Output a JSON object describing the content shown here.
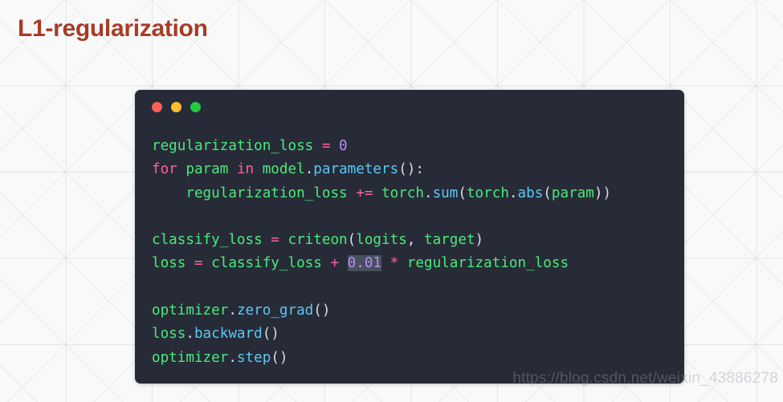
{
  "slide": {
    "title": "L1-regularization",
    "title_color": "#a73c27",
    "background_color": "#f9f9fa"
  },
  "code_window": {
    "background_color": "#272b37",
    "language": "python",
    "traffic_lights": [
      {
        "name": "close-dot",
        "color": "#ff5f56"
      },
      {
        "name": "minimize-dot",
        "color": "#ffbd2e"
      },
      {
        "name": "maximize-dot",
        "color": "#27c93f"
      }
    ],
    "colors": {
      "default_text": "#4aea7b",
      "keyword": "#ff5fa2",
      "operator": "#ff5fa2",
      "number": "#b48ef7",
      "attribute": "#5bc8f5",
      "punctuation": "#d8dde8",
      "selection_background": "#4a4f5e"
    },
    "code_plain": "regularization_loss = 0\nfor param in model.parameters():\n    regularization_loss += torch.sum(torch.abs(param))\n\nclassify_loss = criteon(logits, target)\nloss = classify_loss + 0.01 * regularization_loss\n\noptimizer.zero_grad()\nloss.backward()\noptimizer.step()",
    "lines": [
      {
        "index": 1,
        "tokens": [
          {
            "text": "regularization_loss",
            "type": "name"
          },
          {
            "text": " ",
            "type": "plain"
          },
          {
            "text": "=",
            "type": "operator"
          },
          {
            "text": " ",
            "type": "plain"
          },
          {
            "text": "0",
            "type": "number"
          }
        ]
      },
      {
        "index": 2,
        "tokens": [
          {
            "text": "for",
            "type": "keyword"
          },
          {
            "text": " ",
            "type": "plain"
          },
          {
            "text": "param",
            "type": "name"
          },
          {
            "text": " ",
            "type": "plain"
          },
          {
            "text": "in",
            "type": "keyword"
          },
          {
            "text": " ",
            "type": "plain"
          },
          {
            "text": "model",
            "type": "name"
          },
          {
            "text": ".",
            "type": "punctuation"
          },
          {
            "text": "parameters",
            "type": "attribute"
          },
          {
            "text": "()",
            "type": "punctuation"
          },
          {
            "text": ":",
            "type": "punctuation"
          }
        ]
      },
      {
        "index": 3,
        "tokens": [
          {
            "text": "    ",
            "type": "plain"
          },
          {
            "text": "regularization_loss",
            "type": "name"
          },
          {
            "text": " ",
            "type": "plain"
          },
          {
            "text": "+=",
            "type": "operator"
          },
          {
            "text": " ",
            "type": "plain"
          },
          {
            "text": "torch",
            "type": "name"
          },
          {
            "text": ".",
            "type": "punctuation"
          },
          {
            "text": "sum",
            "type": "attribute"
          },
          {
            "text": "(",
            "type": "punctuation"
          },
          {
            "text": "torch",
            "type": "name"
          },
          {
            "text": ".",
            "type": "punctuation"
          },
          {
            "text": "abs",
            "type": "attribute"
          },
          {
            "text": "(",
            "type": "punctuation"
          },
          {
            "text": "param",
            "type": "name"
          },
          {
            "text": "))",
            "type": "punctuation"
          }
        ]
      },
      {
        "index": 4,
        "tokens": []
      },
      {
        "index": 5,
        "tokens": [
          {
            "text": "classify_loss",
            "type": "name"
          },
          {
            "text": " ",
            "type": "plain"
          },
          {
            "text": "=",
            "type": "operator"
          },
          {
            "text": " ",
            "type": "plain"
          },
          {
            "text": "criteon",
            "type": "name"
          },
          {
            "text": "(",
            "type": "punctuation"
          },
          {
            "text": "logits",
            "type": "name"
          },
          {
            "text": ",",
            "type": "punctuation"
          },
          {
            "text": " ",
            "type": "plain"
          },
          {
            "text": "target",
            "type": "name"
          },
          {
            "text": ")",
            "type": "punctuation"
          }
        ]
      },
      {
        "index": 6,
        "tokens": [
          {
            "text": "loss",
            "type": "name"
          },
          {
            "text": " ",
            "type": "plain"
          },
          {
            "text": "=",
            "type": "operator"
          },
          {
            "text": " ",
            "type": "plain"
          },
          {
            "text": "classify_loss",
            "type": "name"
          },
          {
            "text": " ",
            "type": "plain"
          },
          {
            "text": "+",
            "type": "operator"
          },
          {
            "text": " ",
            "type": "plain"
          },
          {
            "text": "0.01",
            "type": "number",
            "selected": true
          },
          {
            "text": " ",
            "type": "plain"
          },
          {
            "text": "*",
            "type": "operator"
          },
          {
            "text": " ",
            "type": "plain"
          },
          {
            "text": "regularization_loss",
            "type": "name"
          }
        ]
      },
      {
        "index": 7,
        "tokens": []
      },
      {
        "index": 8,
        "tokens": [
          {
            "text": "optimizer",
            "type": "name"
          },
          {
            "text": ".",
            "type": "punctuation"
          },
          {
            "text": "zero_grad",
            "type": "attribute"
          },
          {
            "text": "()",
            "type": "punctuation"
          }
        ]
      },
      {
        "index": 9,
        "tokens": [
          {
            "text": "loss",
            "type": "name"
          },
          {
            "text": ".",
            "type": "punctuation"
          },
          {
            "text": "backward",
            "type": "attribute"
          },
          {
            "text": "()",
            "type": "punctuation"
          }
        ]
      },
      {
        "index": 10,
        "tokens": [
          {
            "text": "optimizer",
            "type": "name"
          },
          {
            "text": ".",
            "type": "punctuation"
          },
          {
            "text": "step",
            "type": "attribute"
          },
          {
            "text": "()",
            "type": "punctuation"
          }
        ]
      }
    ]
  },
  "watermark": {
    "text": "https://blog.csdn.net/weixin_43886278"
  }
}
